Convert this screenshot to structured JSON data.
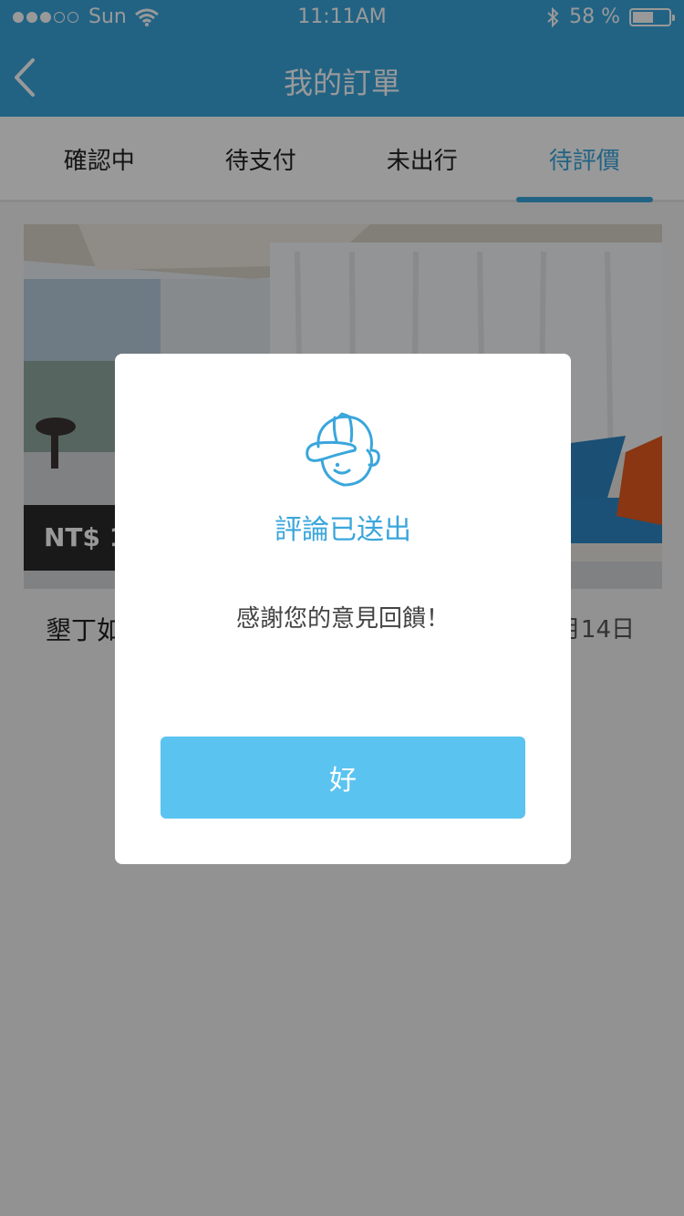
{
  "status_bar": {
    "carrier": "Sun",
    "time": "11:11AM",
    "battery": "58 %",
    "battery_level": 0.58,
    "signal_icon": "signal-dots-icon",
    "wifi_icon": "wifi-icon",
    "bluetooth_icon": "bluetooth-icon"
  },
  "header": {
    "title": "我的訂單",
    "back_icon": "chevron-left-icon"
  },
  "tabs": [
    {
      "label": "確認中"
    },
    {
      "label": "待支付"
    },
    {
      "label": "未出行"
    },
    {
      "label": "待評價",
      "active": true
    }
  ],
  "order_card": {
    "price": "NT$ 1",
    "title": "墾丁如",
    "date": "月14日"
  },
  "modal": {
    "icon": "boy-cap-face-icon",
    "heading": "評論已送出",
    "message": "感謝您的意見回饋！",
    "ok_label": "好"
  },
  "colors": {
    "brand": "#3aa6dc",
    "button": "#5bc3f0"
  }
}
